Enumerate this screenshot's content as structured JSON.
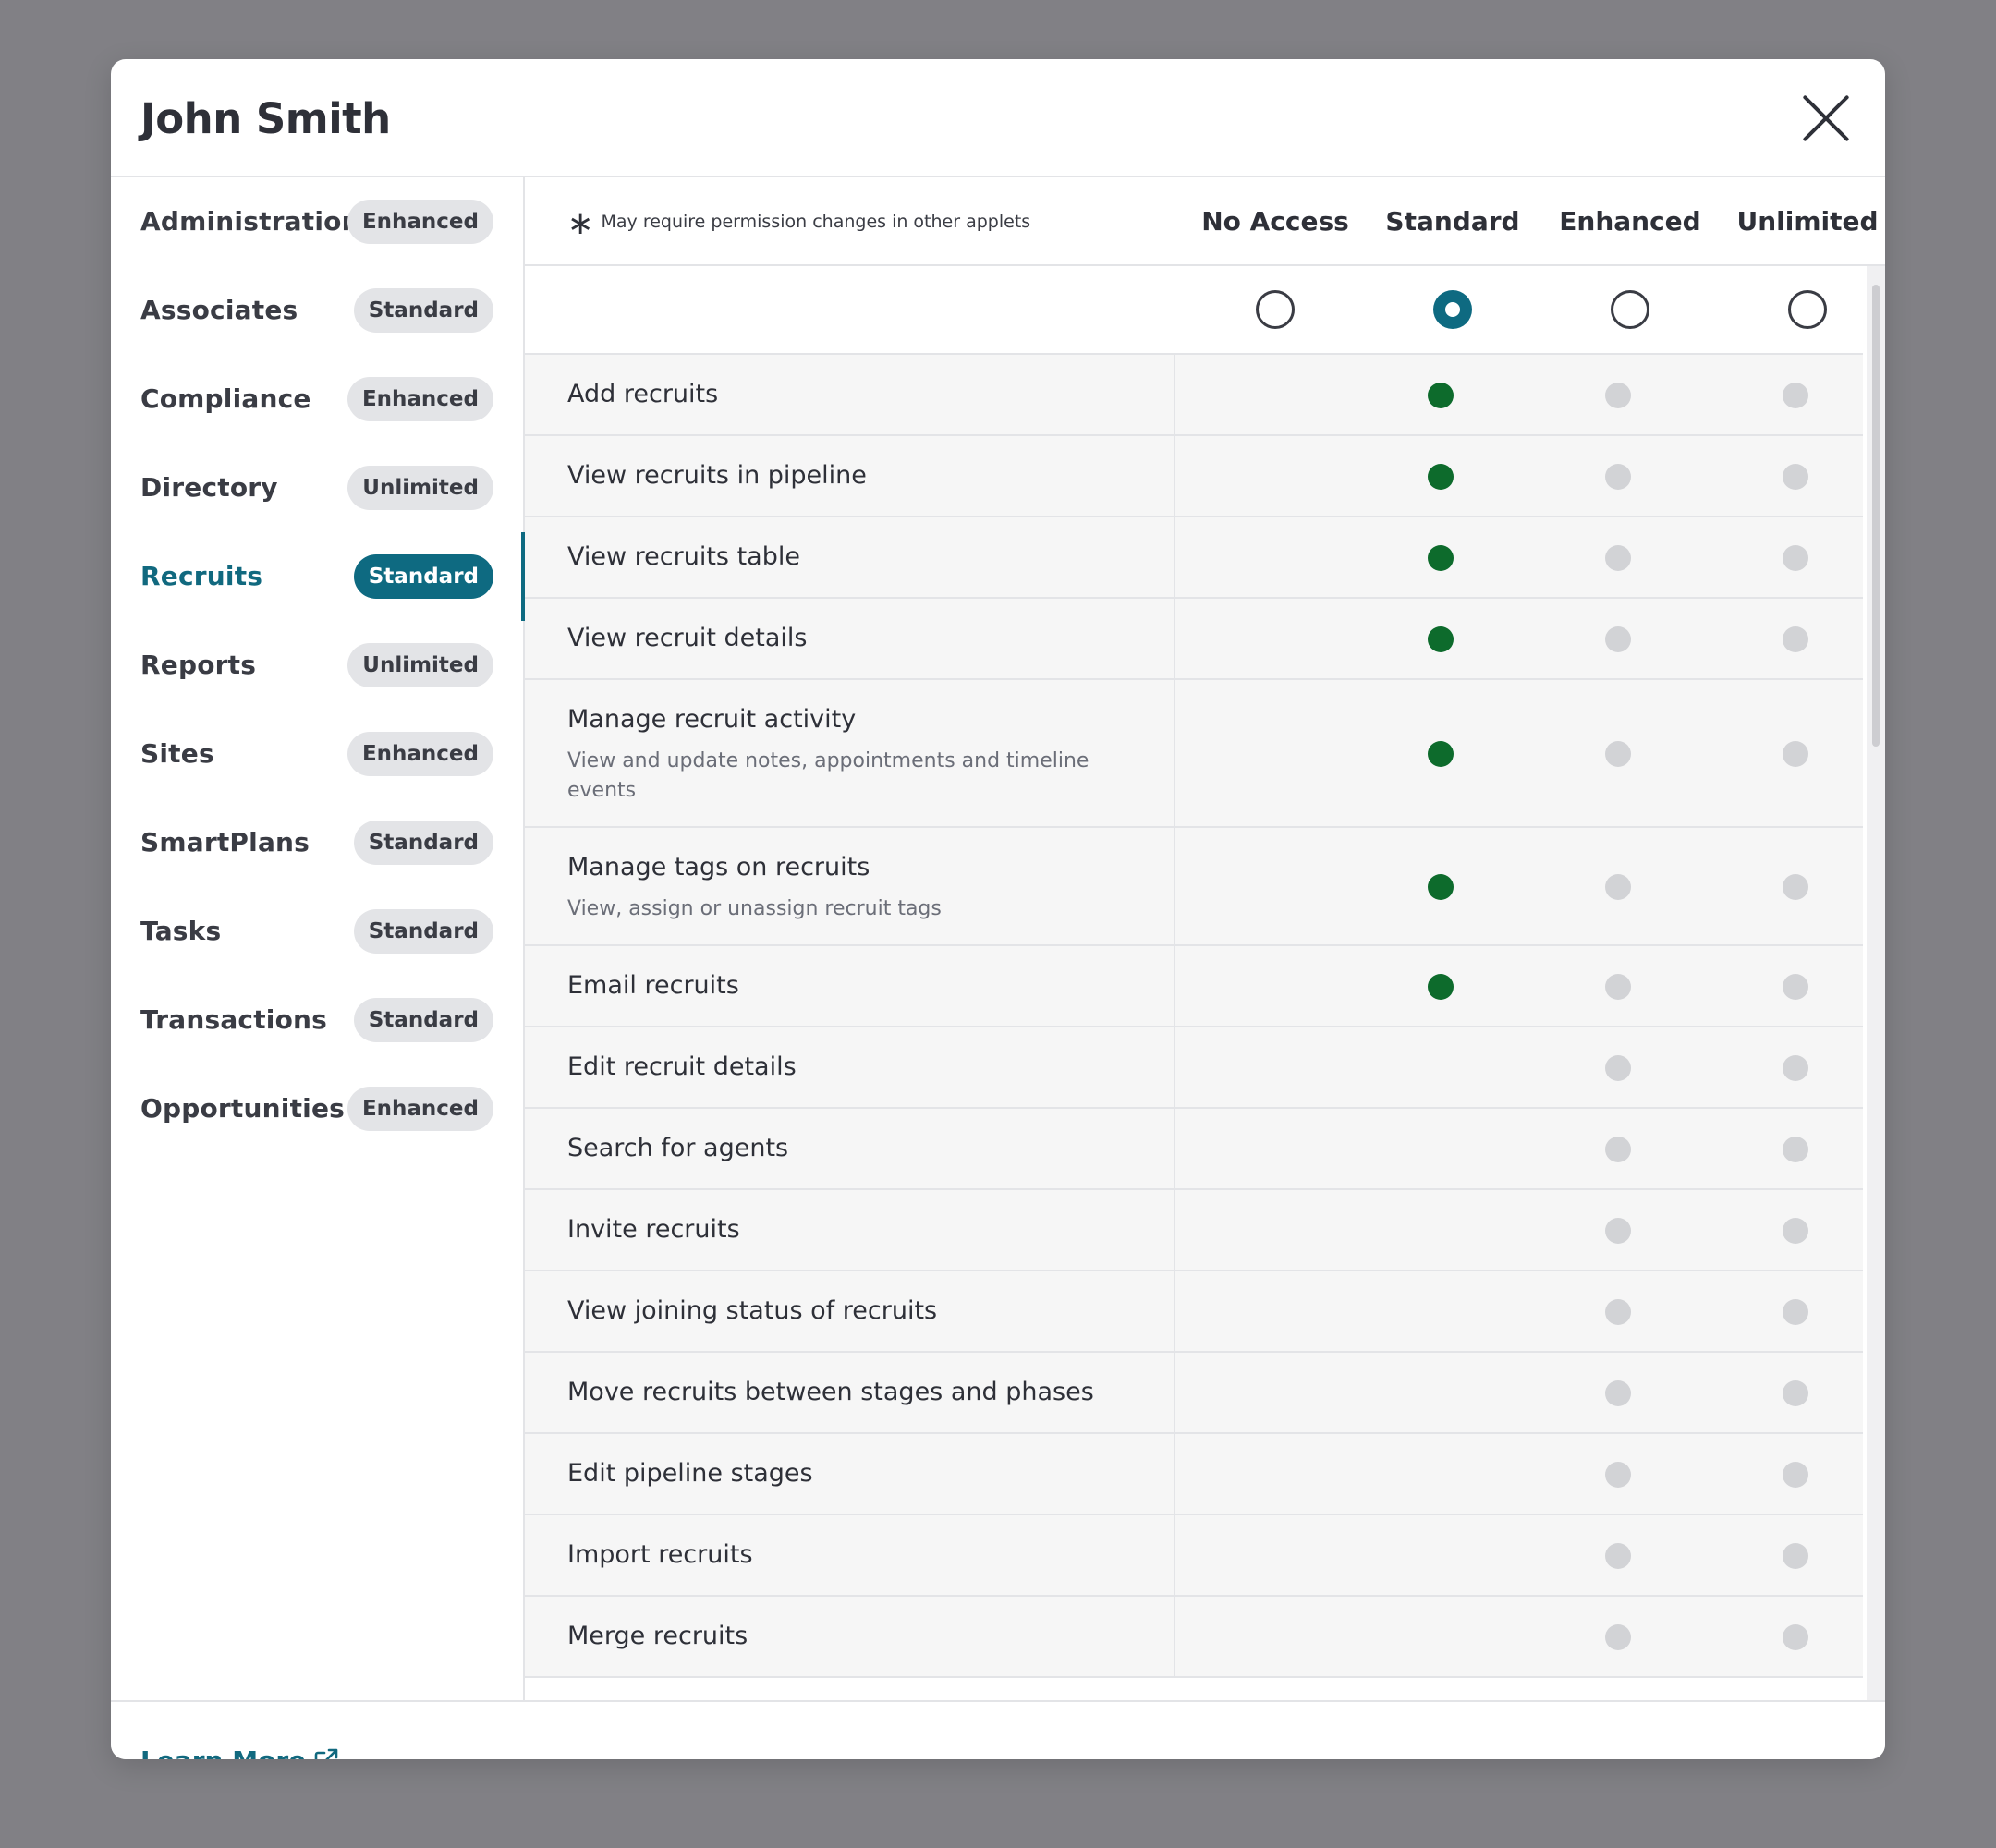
{
  "modal": {
    "title": "John Smith",
    "close_icon": "close-icon",
    "footer": {
      "learn_more": "Learn More",
      "icon": "external-link-icon"
    }
  },
  "sidebar": {
    "items": [
      {
        "label": "Administration",
        "badge": "Enhanced",
        "active": false
      },
      {
        "label": "Associates",
        "badge": "Standard",
        "active": false
      },
      {
        "label": "Compliance",
        "badge": "Enhanced",
        "active": false
      },
      {
        "label": "Directory",
        "badge": "Unlimited",
        "active": false
      },
      {
        "label": "Recruits",
        "badge": "Standard",
        "active": true
      },
      {
        "label": "Reports",
        "badge": "Unlimited",
        "active": false
      },
      {
        "label": "Sites",
        "badge": "Enhanced",
        "active": false
      },
      {
        "label": "SmartPlans",
        "badge": "Standard",
        "active": false
      },
      {
        "label": "Tasks",
        "badge": "Standard",
        "active": false
      },
      {
        "label": "Transactions",
        "badge": "Standard",
        "active": false
      },
      {
        "label": "Opportunities",
        "badge": "Enhanced",
        "active": false
      }
    ]
  },
  "permissions": {
    "note": "May require permission changes in other applets",
    "note_icon": "asterisk-icon",
    "levels": [
      "No Access",
      "Standard",
      "Enhanced",
      "Unlimited"
    ],
    "selected_level": "Standard",
    "rows": [
      {
        "label": "Add recruits",
        "sub": "",
        "levels": [
          false,
          true,
          true,
          true
        ],
        "granted": [
          false,
          true,
          false,
          false
        ]
      },
      {
        "label": "View recruits in pipeline",
        "sub": "",
        "levels": [
          false,
          true,
          true,
          true
        ],
        "granted": [
          false,
          true,
          false,
          false
        ]
      },
      {
        "label": "View recruits table",
        "sub": "",
        "levels": [
          false,
          true,
          true,
          true
        ],
        "granted": [
          false,
          true,
          false,
          false
        ]
      },
      {
        "label": "View recruit details",
        "sub": "",
        "levels": [
          false,
          true,
          true,
          true
        ],
        "granted": [
          false,
          true,
          false,
          false
        ]
      },
      {
        "label": "Manage recruit activity",
        "sub": "View and update notes, appointments and timeline events",
        "levels": [
          false,
          true,
          true,
          true
        ],
        "granted": [
          false,
          true,
          false,
          false
        ]
      },
      {
        "label": "Manage tags on recruits",
        "sub": "View, assign or unassign recruit tags",
        "levels": [
          false,
          true,
          true,
          true
        ],
        "granted": [
          false,
          true,
          false,
          false
        ]
      },
      {
        "label": "Email recruits",
        "sub": "",
        "levels": [
          false,
          true,
          true,
          true
        ],
        "granted": [
          false,
          true,
          false,
          false
        ]
      },
      {
        "label": "Edit recruit details",
        "sub": "",
        "levels": [
          false,
          false,
          true,
          true
        ],
        "granted": [
          false,
          false,
          false,
          false
        ]
      },
      {
        "label": "Search for agents",
        "sub": "",
        "levels": [
          false,
          false,
          true,
          true
        ],
        "granted": [
          false,
          false,
          false,
          false
        ]
      },
      {
        "label": "Invite recruits",
        "sub": "",
        "levels": [
          false,
          false,
          true,
          true
        ],
        "granted": [
          false,
          false,
          false,
          false
        ]
      },
      {
        "label": "View joining status of recruits",
        "sub": "",
        "levels": [
          false,
          false,
          true,
          true
        ],
        "granted": [
          false,
          false,
          false,
          false
        ]
      },
      {
        "label": "Move recruits between stages and phases",
        "sub": "",
        "levels": [
          false,
          false,
          true,
          true
        ],
        "granted": [
          false,
          false,
          false,
          false
        ]
      },
      {
        "label": "Edit pipeline stages",
        "sub": "",
        "levels": [
          false,
          false,
          true,
          true
        ],
        "granted": [
          false,
          false,
          false,
          false
        ]
      },
      {
        "label": "Import recruits",
        "sub": "",
        "levels": [
          false,
          false,
          true,
          true
        ],
        "granted": [
          false,
          false,
          false,
          false
        ]
      },
      {
        "label": "Merge recruits",
        "sub": "",
        "levels": [
          false,
          false,
          true,
          true
        ],
        "granted": [
          false,
          false,
          false,
          false
        ]
      }
    ]
  },
  "colors": {
    "accent": "#0e6a81",
    "granted_dot": "#0d6b2c",
    "inactive_dot": "#d2d3d6",
    "backdrop": "#818085"
  }
}
